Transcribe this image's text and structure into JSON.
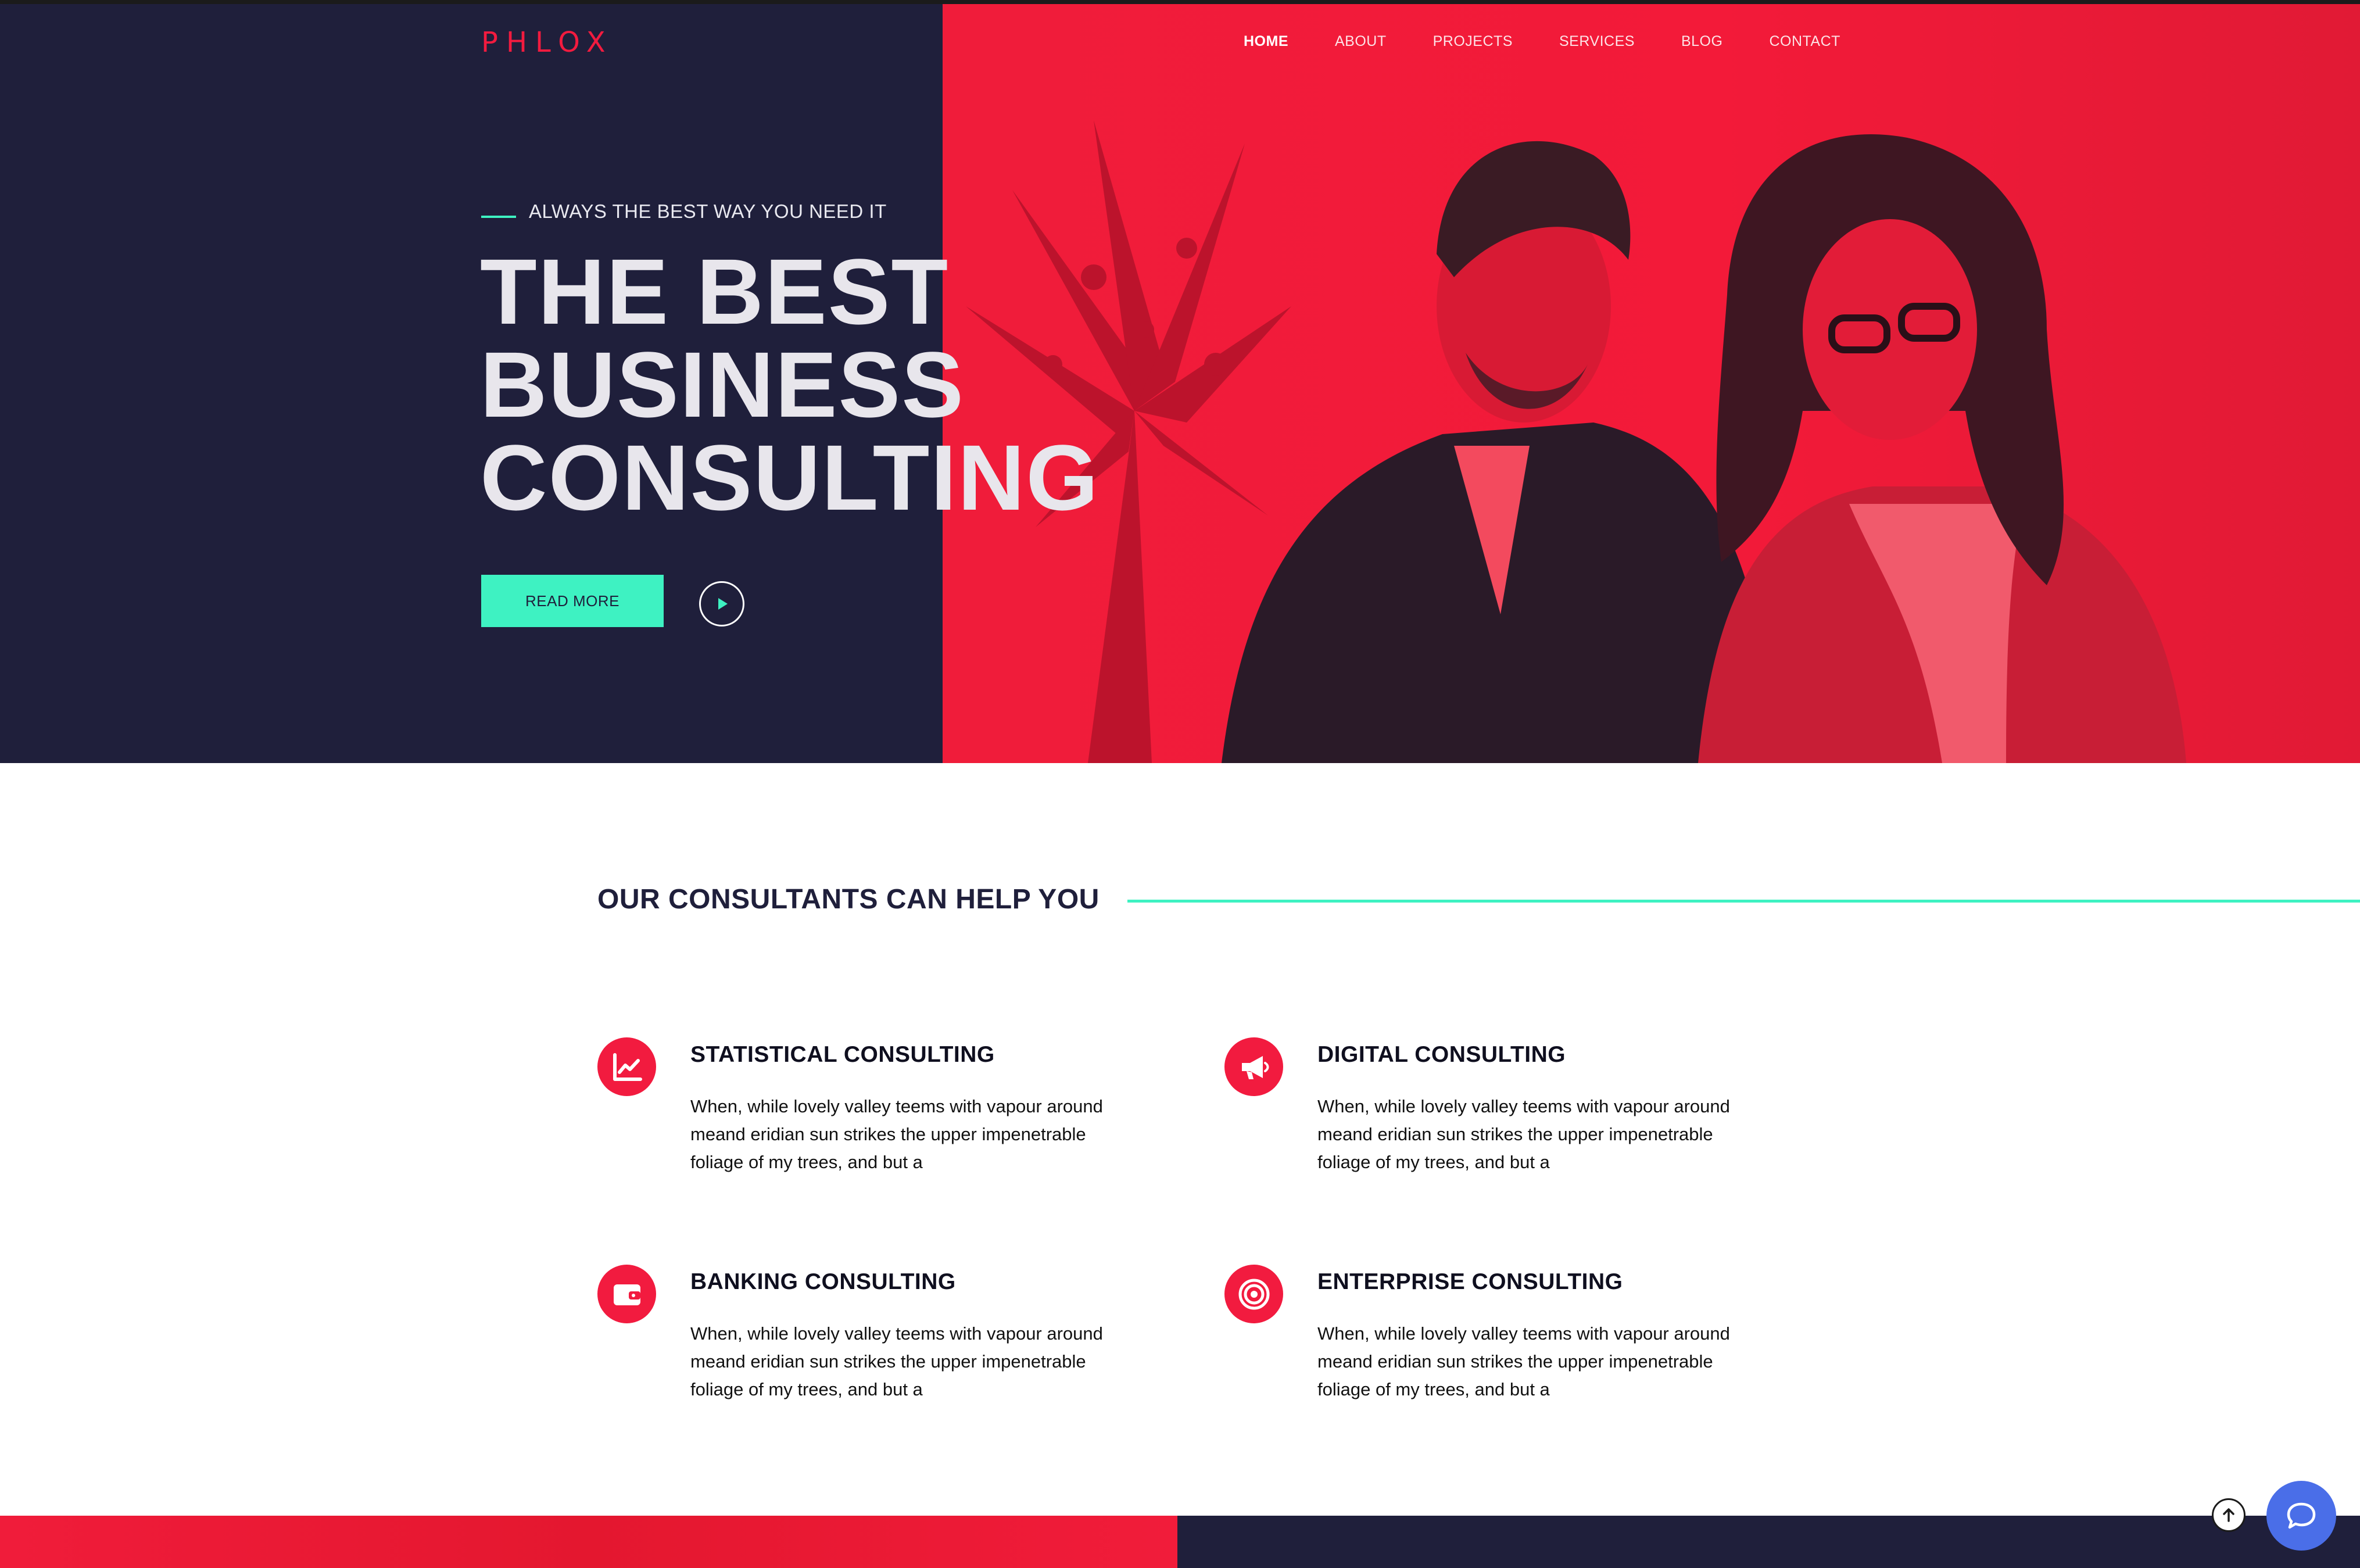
{
  "brand": {
    "logo_text": "PHLOX"
  },
  "nav": {
    "items": [
      {
        "label": "HOME",
        "active": true
      },
      {
        "label": "ABOUT",
        "active": false
      },
      {
        "label": "PROJECTS",
        "active": false
      },
      {
        "label": "SERVICES",
        "active": false
      },
      {
        "label": "BLOG",
        "active": false
      },
      {
        "label": "CONTACT",
        "active": false
      }
    ]
  },
  "hero": {
    "eyebrow": "ALWAYS THE BEST WAY YOU NEED IT",
    "title_lines": [
      "THE BEST",
      "BUSINESS",
      "CONSULTING"
    ],
    "cta_label": "READ MORE",
    "play_icon": "play-icon"
  },
  "services": {
    "heading": "OUR CONSULTANTS CAN HELP YOU",
    "items": [
      {
        "icon": "chart-line-icon",
        "title": "STATISTICAL CONSULTING",
        "text": "When, while lovely valley teems with vapour around meand eridian sun strikes the upper impenetrable foliage of my trees, and but a"
      },
      {
        "icon": "megaphone-icon",
        "title": "DIGITAL CONSULTING",
        "text": "When, while lovely valley teems with vapour around meand eridian sun strikes the upper impenetrable foliage of my trees, and but a"
      },
      {
        "icon": "wallet-icon",
        "title": "BANKING CONSULTING",
        "text": "When, while lovely valley teems with vapour around meand eridian sun strikes the upper impenetrable foliage of my trees, and but a"
      },
      {
        "icon": "target-icon",
        "title": "ENTERPRISE CONSULTING",
        "text": "When, while lovely valley teems with vapour around meand eridian sun strikes the upper impenetrable foliage of my trees, and but a"
      }
    ]
  },
  "floating": {
    "scroll_top_icon": "arrow-up-icon",
    "chat_icon": "chat-bubble-icon"
  },
  "colors": {
    "accent_red": "#f21b3f",
    "accent_teal": "#3ef2c2",
    "navy": "#1f1f3b",
    "chat_blue": "#4a6ee8"
  }
}
